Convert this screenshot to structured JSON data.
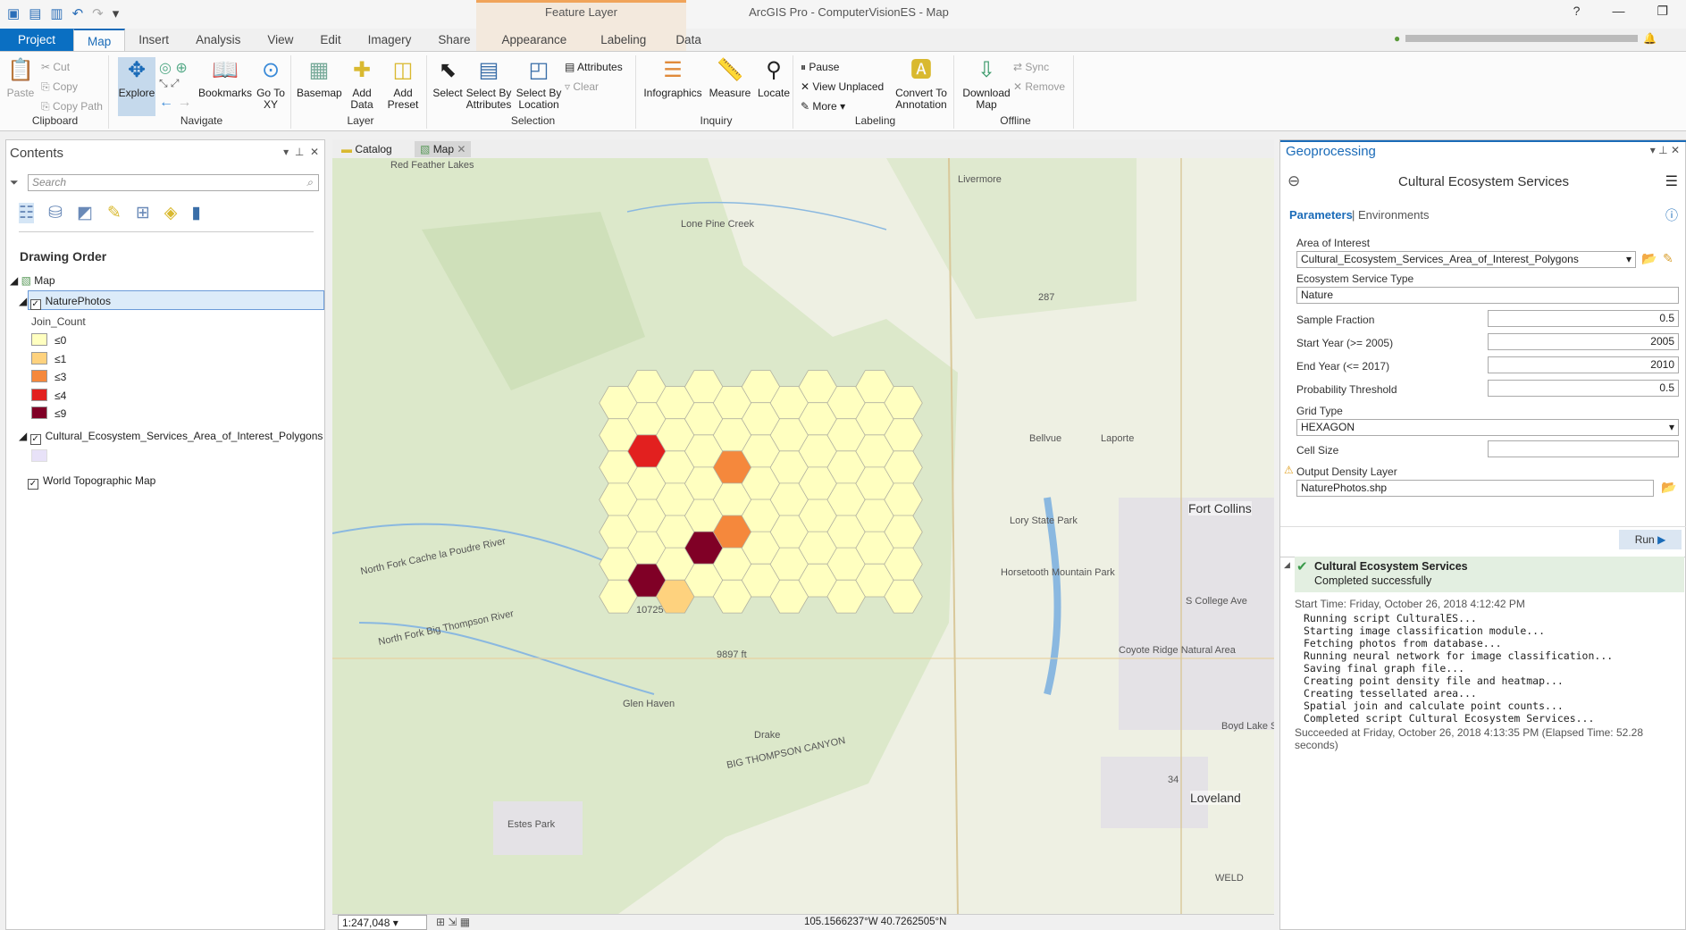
{
  "app": {
    "title": "ArcGIS Pro - ComputerVisionES - Map",
    "context_tab": "Feature Layer",
    "help": "?",
    "minimize": "—",
    "restore": "❐"
  },
  "tabs": [
    {
      "label": "Project"
    },
    {
      "label": "Map"
    },
    {
      "label": "Insert"
    },
    {
      "label": "Analysis"
    },
    {
      "label": "View"
    },
    {
      "label": "Edit"
    },
    {
      "label": "Imagery"
    },
    {
      "label": "Share"
    },
    {
      "label": "Appearance"
    },
    {
      "label": "Labeling"
    },
    {
      "label": "Data"
    }
  ],
  "ribbon": {
    "clipboard": {
      "label": "Clipboard",
      "paste": "Paste",
      "cut": "Cut",
      "copy": "Copy",
      "copy_path": "Copy Path"
    },
    "navigate": {
      "label": "Navigate",
      "explore": "Explore",
      "bookmarks": "Bookmarks",
      "goto": "Go To XY"
    },
    "layer": {
      "label": "Layer",
      "basemap": "Basemap",
      "add_data": "Add Data",
      "add_preset": "Add Preset"
    },
    "selection": {
      "label": "Selection",
      "select": "Select",
      "by_attr": "Select By Attributes",
      "by_loc": "Select By Location",
      "attributes": "Attributes",
      "clear": "Clear"
    },
    "inquiry": {
      "label": "Inquiry",
      "infographics": "Infographics",
      "measure": "Measure",
      "locate": "Locate"
    },
    "labeling": {
      "label": "Labeling",
      "pause": "Pause",
      "view_unplaced": "View Unplaced",
      "more": "More",
      "convert": "Convert To Annotation"
    },
    "offline": {
      "label": "Offline",
      "download": "Download Map",
      "sync": "Sync",
      "remove": "Remove"
    }
  },
  "contents": {
    "title": "Contents",
    "search_placeholder": "Search",
    "drawing_order": "Drawing Order",
    "map": "Map",
    "layer1": "NaturePhotos",
    "field": "Join_Count",
    "legend": [
      {
        "label": "≤0",
        "color": "#ffffc0"
      },
      {
        "label": "≤1",
        "color": "#fed27e"
      },
      {
        "label": "≤3",
        "color": "#f5883c"
      },
      {
        "label": "≤4",
        "color": "#e2201f"
      },
      {
        "label": "≤9",
        "color": "#800026"
      }
    ],
    "layer2": "Cultural_Ecosystem_Services_Area_of_Interest_Polygons",
    "layer2_color": "#e8e2f8",
    "layer3": "World Topographic Map"
  },
  "map_tabs": {
    "catalog": "Catalog",
    "map": "Map"
  },
  "map": {
    "labels": [
      "Red Feather Lakes",
      "Livermore",
      "Lone Pine Creek",
      "Bellvue",
      "Laporte",
      "Fort Collins",
      "Horsetooth Mountain Park",
      "Lory State Park",
      "North Fork Cache la Poudre River",
      "North Fork Big Thompson River",
      "Glen Haven",
      "Drake",
      "BIG THOMPSON CANYON",
      "Estes Park",
      "Loveland",
      "WELD",
      "9897 ft",
      "10725 ft",
      "Boyd Lake State Park",
      "S College Ave",
      "Coyote Ridge Natural Area",
      "287",
      "34"
    ],
    "hex_counts": [
      [
        0,
        0,
        0,
        0,
        0,
        0,
        0
      ],
      [
        0,
        0,
        4,
        0,
        0,
        0,
        9
      ],
      [
        0,
        0,
        0,
        0,
        0,
        0,
        1
      ],
      [
        0,
        0,
        0,
        0,
        0,
        9,
        0
      ],
      [
        0,
        0,
        3,
        0,
        3,
        0,
        0
      ],
      [
        0,
        0,
        0,
        0,
        0,
        0,
        0
      ],
      [
        0,
        0,
        0,
        0,
        0,
        0,
        0
      ],
      [
        0,
        0,
        0,
        0,
        0,
        0,
        0
      ],
      [
        0,
        0,
        0,
        0,
        0,
        0,
        0
      ],
      [
        0,
        0,
        0,
        0,
        0,
        0,
        0
      ],
      [
        0,
        0,
        0,
        0,
        0,
        0,
        0
      ]
    ]
  },
  "status": {
    "scale": "1:247,048",
    "coords": "105.1566237°W 40.7262505°N"
  },
  "gp": {
    "title": "Geoprocessing",
    "tool": "Cultural Ecosystem Services",
    "tab_params": "Parameters",
    "tab_env": "Environments",
    "aoi_label": "Area of Interest",
    "aoi_value": "Cultural_Ecosystem_Services_Area_of_Interest_Polygons",
    "est_label": "Ecosystem Service Type",
    "est_value": "Nature",
    "sf_label": "Sample Fraction",
    "sf_value": "0.5",
    "sy_label": "Start Year (>= 2005)",
    "sy_value": "2005",
    "ey_label": "End Year (<= 2017)",
    "ey_value": "2010",
    "pt_label": "Probability Threshold",
    "pt_value": "0.5",
    "gt_label": "Grid Type",
    "gt_value": "HEXAGON",
    "cs_label": "Cell Size",
    "cs_value": "",
    "odl_label": "Output Density Layer",
    "odl_value": "NaturePhotos.shp",
    "run": "Run",
    "msg_title": "Cultural Ecosystem Services",
    "msg_status": "Completed successfully",
    "start_time": "Start Time: Friday, October 26, 2018 4:12:42 PM",
    "log": [
      "Running script CulturalES...",
      "Starting image classification module...",
      "Fetching photos from database...",
      "Running neural network for image classification...",
      "Saving final graph file...",
      "Creating point density file and heatmap...",
      "Creating tessellated area...",
      "Spatial join and calculate point counts...",
      "Completed script Cultural Ecosystem Services..."
    ],
    "end_time": "Succeeded at Friday, October 26, 2018 4:13:35 PM (Elapsed Time: 52.28 seconds)"
  }
}
